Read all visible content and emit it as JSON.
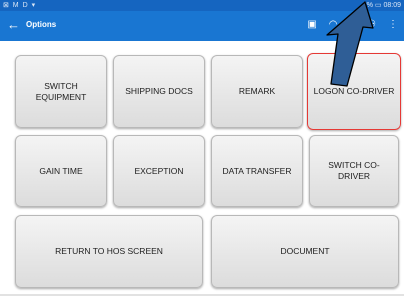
{
  "status_bar": {
    "left_text": "⊠ M D ▾",
    "right_text": "2% ▭ 08:09"
  },
  "app_bar": {
    "back_icon": "arrow-left-icon",
    "title": "Options",
    "action_icons": [
      "message-icon",
      "wifi-icon",
      "signal-icon",
      "person-icon",
      "more-icon"
    ]
  },
  "buttons": {
    "switch_equipment": "SWITCH\nEQUIPMENT",
    "shipping_docs": "SHIPPING DOCS",
    "remark": "REMARK",
    "logon_co_driver": "LOGON CO-DRIVER",
    "gain_time": "GAIN TIME",
    "exception": "EXCEPTION",
    "data_transfer": "DATA TRANSFER",
    "switch_co_driver": "SWITCH CO-\nDRIVER",
    "return_to_hos": "RETURN TO HOS SCREEN",
    "document": "DOCUMENT"
  },
  "selected_button": "LOGON CO-DRIVER",
  "colors": {
    "status_bar": "#1565c0",
    "app_bar": "#1976d2",
    "selection_border": "#e53935",
    "pointer_arrow": "#2f5e96"
  }
}
